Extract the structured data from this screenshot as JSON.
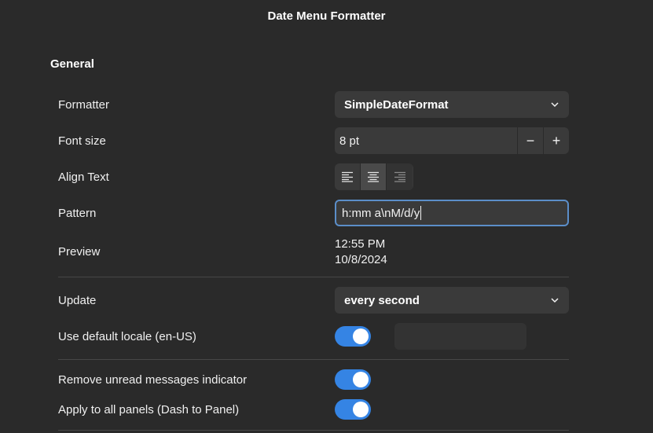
{
  "window": {
    "title": "Date Menu Formatter"
  },
  "general": {
    "title": "General",
    "formatter": {
      "label": "Formatter",
      "value": "SimpleDateFormat"
    },
    "font_size": {
      "label": "Font size",
      "value": "8 pt",
      "minus": "−",
      "plus": "+"
    },
    "align_text": {
      "label": "Align Text",
      "options": [
        "left",
        "center",
        "right"
      ],
      "selected": "center"
    },
    "pattern": {
      "label": "Pattern",
      "value": "h:mm a\\nM/d/y"
    },
    "preview": {
      "label": "Preview",
      "line1": "12:55 PM",
      "line2": "10/8/2024"
    },
    "update": {
      "label": "Update",
      "value": "every second"
    },
    "default_locale": {
      "label": "Use default locale (en-US)",
      "enabled": true,
      "locale_value": ""
    },
    "remove_unread": {
      "label": "Remove unread messages indicator",
      "enabled": true
    },
    "apply_all_panels": {
      "label": "Apply to all panels (Dash to Panel)",
      "enabled": true
    }
  },
  "colors": {
    "accent": "#3584e4",
    "background": "#2a2a2a",
    "control": "#3a3a3a",
    "focus": "#5b8ec9"
  }
}
